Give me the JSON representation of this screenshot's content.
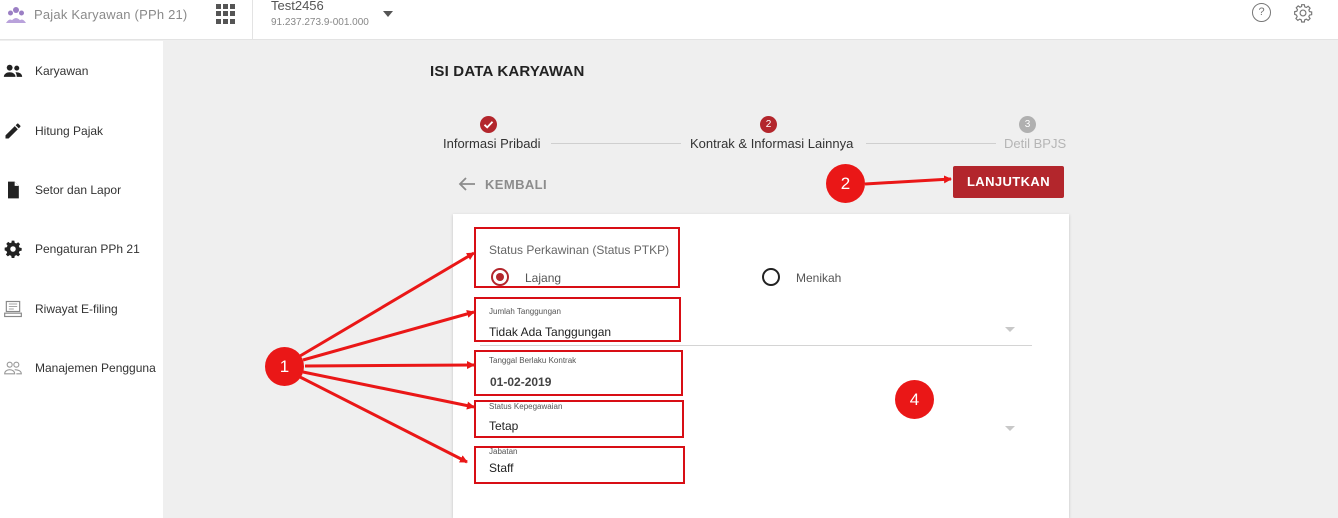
{
  "topbar": {
    "app_title": "Pajak Karyawan (PPh 21)",
    "company_name": "Test2456",
    "company_npwp": "91.237.273.9-001.000",
    "help_glyph": "?"
  },
  "sidebar": {
    "items": [
      {
        "label": "Karyawan",
        "icon": "people-icon"
      },
      {
        "label": "Hitung Pajak",
        "icon": "pencil-icon"
      },
      {
        "label": "Setor dan Lapor",
        "icon": "document-icon"
      },
      {
        "label": "Pengaturan PPh 21",
        "icon": "gear-icon"
      },
      {
        "label": "Riwayat E-filing",
        "icon": "computer-icon"
      },
      {
        "label": "Manajemen Pengguna",
        "icon": "users-icon"
      }
    ]
  },
  "main": {
    "title": "ISI DATA KARYAWAN",
    "steps": [
      {
        "number": "1",
        "label": "Informasi Pribadi",
        "state": "done"
      },
      {
        "number": "2",
        "label": "Kontrak & Informasi Lainnya",
        "state": "active"
      },
      {
        "number": "3",
        "label": "Detil BPJS",
        "state": "pending"
      }
    ],
    "back_label": "KEMBALI",
    "next_label": "LANJUTKAN"
  },
  "form": {
    "marital": {
      "label": "Status Perkawinan (Status PTKP)",
      "options": [
        {
          "label": "Lajang",
          "selected": true
        },
        {
          "label": "Menikah",
          "selected": false
        }
      ]
    },
    "dependents": {
      "label": "Jumlah Tanggungan",
      "value": "Tidak Ada Tanggungan"
    },
    "contract_date": {
      "label": "Tanggal Berlaku Kontrak",
      "value": "01-02-2019"
    },
    "employment_status": {
      "label": "Status Kepegawaian",
      "value": "Tetap"
    },
    "position": {
      "label": "Jabatan",
      "value": "Staff"
    }
  },
  "annotations": {
    "badge_1": "1",
    "badge_2": "2",
    "badge_4": "4"
  },
  "colors": {
    "brand_red": "#b3262c",
    "annotation_red": "#ea1717",
    "step_pending": "#b0b0b0"
  }
}
